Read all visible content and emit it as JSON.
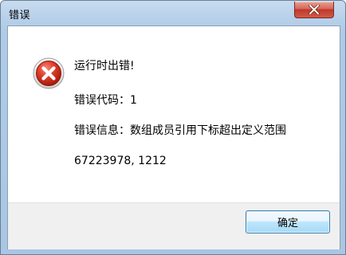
{
  "window": {
    "title": "错误"
  },
  "message": {
    "line1": "运行时出错!",
    "line2": "错误代码：1",
    "line3": "错误信息：数组成员引用下标超出定义范围",
    "line4": "67223978, 1212"
  },
  "buttons": {
    "ok_label": "确定"
  },
  "icons": {
    "error": "error-icon",
    "close": "close-icon"
  },
  "colors": {
    "error_red": "#d42a1c",
    "close_button": "#c0382a",
    "button_border": "#3c7fb1"
  }
}
